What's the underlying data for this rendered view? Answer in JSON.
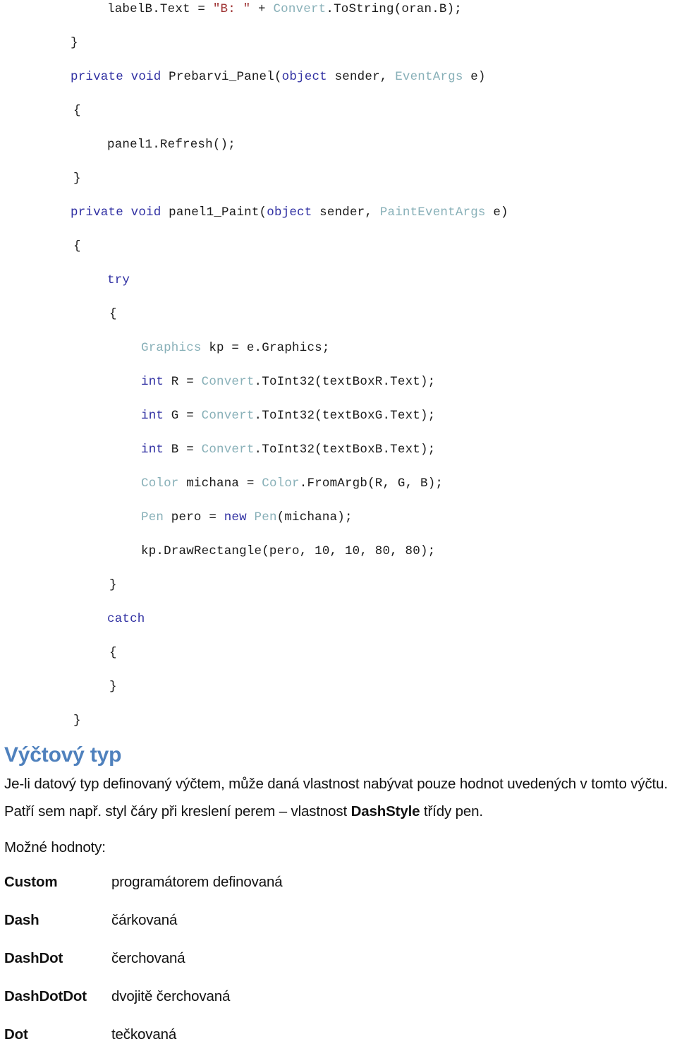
{
  "colors": {
    "keyword": "#2f2fa2",
    "type": "#88b0b8",
    "string": "#9e3232",
    "plain": "#1a1a1a",
    "heading": "#4f81bd",
    "body": "#121212",
    "page_background": "#ffffff"
  },
  "code": {
    "language": "csharp",
    "lines": [
      {
        "indent": 2,
        "tokens": [
          {
            "t": "labelB.Text = ",
            "c": "pl"
          },
          {
            "t": "\"B: \"",
            "c": "str"
          },
          {
            "t": " + ",
            "c": "pl"
          },
          {
            "t": "Convert",
            "c": "typ"
          },
          {
            "t": ".ToString(oran.B);",
            "c": "pl"
          }
        ]
      },
      {
        "indent": 0,
        "tokens": [
          {
            "t": "}",
            "c": "pl"
          }
        ]
      },
      {
        "indent": 0,
        "tokens": [
          {
            "t": "private void ",
            "c": "kw"
          },
          {
            "t": "Prebarvi_Panel(",
            "c": "pl"
          },
          {
            "t": "object",
            "c": "kw"
          },
          {
            "t": " sender, ",
            "c": "pl"
          },
          {
            "t": "EventArgs",
            "c": "typ"
          },
          {
            "t": " e)",
            "c": "pl"
          }
        ]
      },
      {
        "indent": 1,
        "tokens": [
          {
            "t": "{",
            "c": "pl"
          }
        ]
      },
      {
        "indent": 2,
        "tokens": [
          {
            "t": "panel1.Refresh();",
            "c": "pl"
          }
        ]
      },
      {
        "indent": 1,
        "tokens": [
          {
            "t": "}",
            "c": "pl"
          }
        ]
      },
      {
        "indent": 0,
        "tokens": [
          {
            "t": "private void ",
            "c": "kw"
          },
          {
            "t": "panel1_Paint(",
            "c": "pl"
          },
          {
            "t": "object",
            "c": "kw"
          },
          {
            "t": " sender, ",
            "c": "pl"
          },
          {
            "t": "PaintEventArgs",
            "c": "typ"
          },
          {
            "t": " e)",
            "c": "pl"
          }
        ]
      },
      {
        "indent": 1,
        "tokens": [
          {
            "t": "{",
            "c": "pl"
          }
        ]
      },
      {
        "indent": 2,
        "tokens": [
          {
            "t": "try",
            "c": "kw"
          }
        ]
      },
      {
        "indent": 3,
        "tokens": [
          {
            "t": "{",
            "c": "pl"
          }
        ]
      },
      {
        "indent": 4,
        "tokens": [
          {
            "t": "Graphics",
            "c": "typ"
          },
          {
            "t": " kp = e.Graphics;",
            "c": "pl"
          }
        ]
      },
      {
        "indent": 4,
        "tokens": [
          {
            "t": "int",
            "c": "kw"
          },
          {
            "t": " R = ",
            "c": "pl"
          },
          {
            "t": "Convert",
            "c": "typ"
          },
          {
            "t": ".ToInt32(textBoxR.Text);",
            "c": "pl"
          }
        ]
      },
      {
        "indent": 4,
        "tokens": [
          {
            "t": "int",
            "c": "kw"
          },
          {
            "t": " G = ",
            "c": "pl"
          },
          {
            "t": "Convert",
            "c": "typ"
          },
          {
            "t": ".ToInt32(textBoxG.Text);",
            "c": "pl"
          }
        ]
      },
      {
        "indent": 4,
        "tokens": [
          {
            "t": "int",
            "c": "kw"
          },
          {
            "t": " B = ",
            "c": "pl"
          },
          {
            "t": "Convert",
            "c": "typ"
          },
          {
            "t": ".ToInt32(textBoxB.Text);",
            "c": "pl"
          }
        ]
      },
      {
        "indent": 4,
        "tokens": [
          {
            "t": "Color",
            "c": "typ"
          },
          {
            "t": " michana = ",
            "c": "pl"
          },
          {
            "t": "Color",
            "c": "typ"
          },
          {
            "t": ".FromArgb(R, G, B);",
            "c": "pl"
          }
        ]
      },
      {
        "indent": 4,
        "tokens": [
          {
            "t": "Pen",
            "c": "typ"
          },
          {
            "t": " pero = ",
            "c": "pl"
          },
          {
            "t": "new",
            "c": "kw"
          },
          {
            "t": " ",
            "c": "pl"
          },
          {
            "t": "Pen",
            "c": "typ"
          },
          {
            "t": "(michana);",
            "c": "pl"
          }
        ]
      },
      {
        "indent": 4,
        "tokens": [
          {
            "t": "kp.DrawRectangle(pero, 10, 10, 80, 80);",
            "c": "pl"
          }
        ]
      },
      {
        "indent": 3,
        "tokens": [
          {
            "t": "}",
            "c": "pl"
          }
        ]
      },
      {
        "indent": 2,
        "tokens": [
          {
            "t": "catch",
            "c": "kw"
          }
        ]
      },
      {
        "indent": 3,
        "tokens": [
          {
            "t": "{",
            "c": "pl"
          }
        ]
      },
      {
        "indent": 3,
        "tokens": [
          {
            "t": "}",
            "c": "pl"
          }
        ]
      },
      {
        "indent": 1,
        "tokens": [
          {
            "t": "}",
            "c": "pl"
          }
        ]
      }
    ]
  },
  "section": {
    "heading": "Výčtový typ",
    "intro_parts": {
      "before": "Je-li datový typ definovaný výčtem, může daná vlastnost nabývat pouze hodnot uvedených v tomto výčtu. Patří sem např. styl čáry při kreslení perem – vlastnost ",
      "bold": "DashStyle",
      "after": " třídy pen."
    },
    "values_label": "Možné hodnoty:"
  },
  "value_table": {
    "rows": [
      {
        "name": "Custom",
        "description": "programátorem definovaná"
      },
      {
        "name": "Dash",
        "description": "čárkovaná"
      },
      {
        "name": "DashDot",
        "description": "čerchovaná"
      },
      {
        "name": "DashDotDot",
        "description": "dvojitě čerchovaná"
      },
      {
        "name": "Dot",
        "description": "tečkovaná"
      }
    ]
  }
}
